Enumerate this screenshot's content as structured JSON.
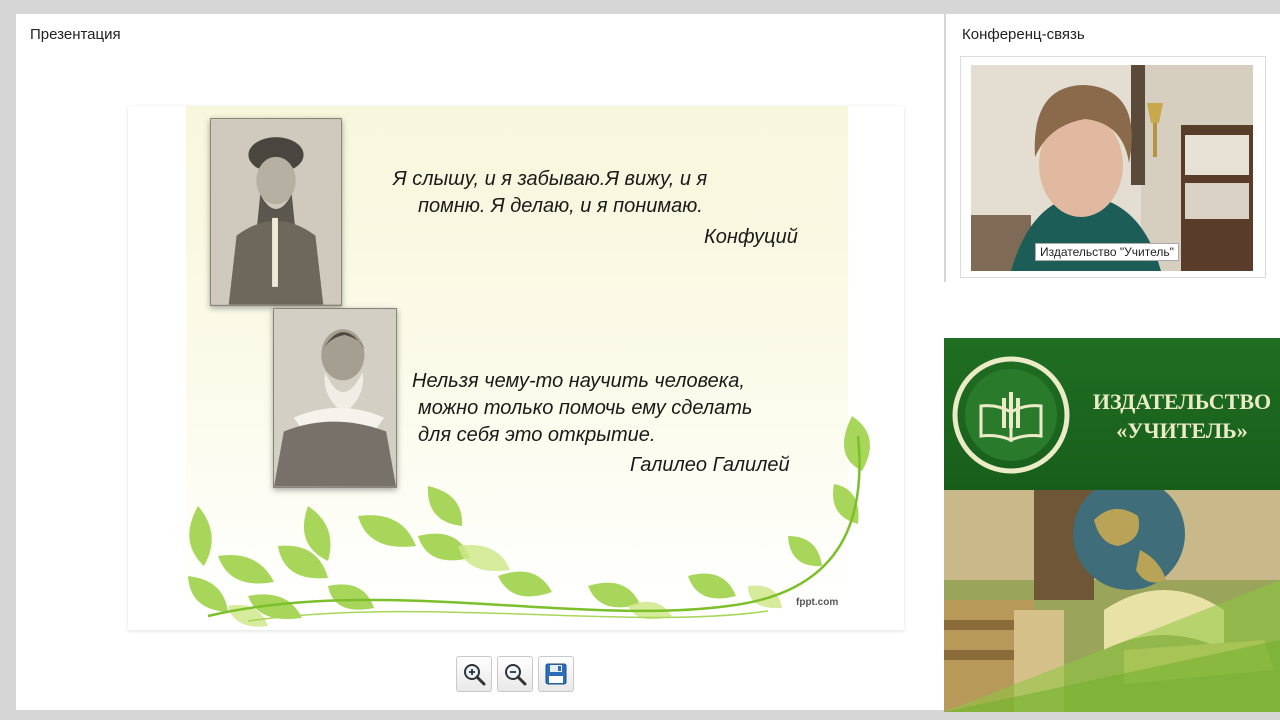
{
  "presentation": {
    "title": "Презентация",
    "slide": {
      "quote1": {
        "line1": "Я слышу, и я забываю.Я вижу, и я",
        "line2": "помню. Я делаю, и я понимаю.",
        "author": "Конфуций"
      },
      "quote2": {
        "line1": "Нельзя чему-то научить человека,",
        "line2": "можно только помочь ему сделать",
        "line3": "для себя это открытие.",
        "author": "Галилео Галилей"
      },
      "watermark": "fppt.com"
    },
    "toolbar": {
      "buttons": [
        {
          "icon": "zoom-in-icon"
        },
        {
          "icon": "zoom-out-icon"
        },
        {
          "icon": "save-icon"
        }
      ]
    }
  },
  "conference": {
    "title": "Конференц-связь",
    "video_caption": "Издательство \"Учитель\""
  },
  "banner": {
    "line1": "ИЗДАТЕЛЬСТВО",
    "line2": "«УЧИТЕЛЬ»"
  },
  "colors": {
    "banner_green": "#1f6e22",
    "banner_text": "#ecebc7",
    "leaf_green": "#8cc63f"
  }
}
